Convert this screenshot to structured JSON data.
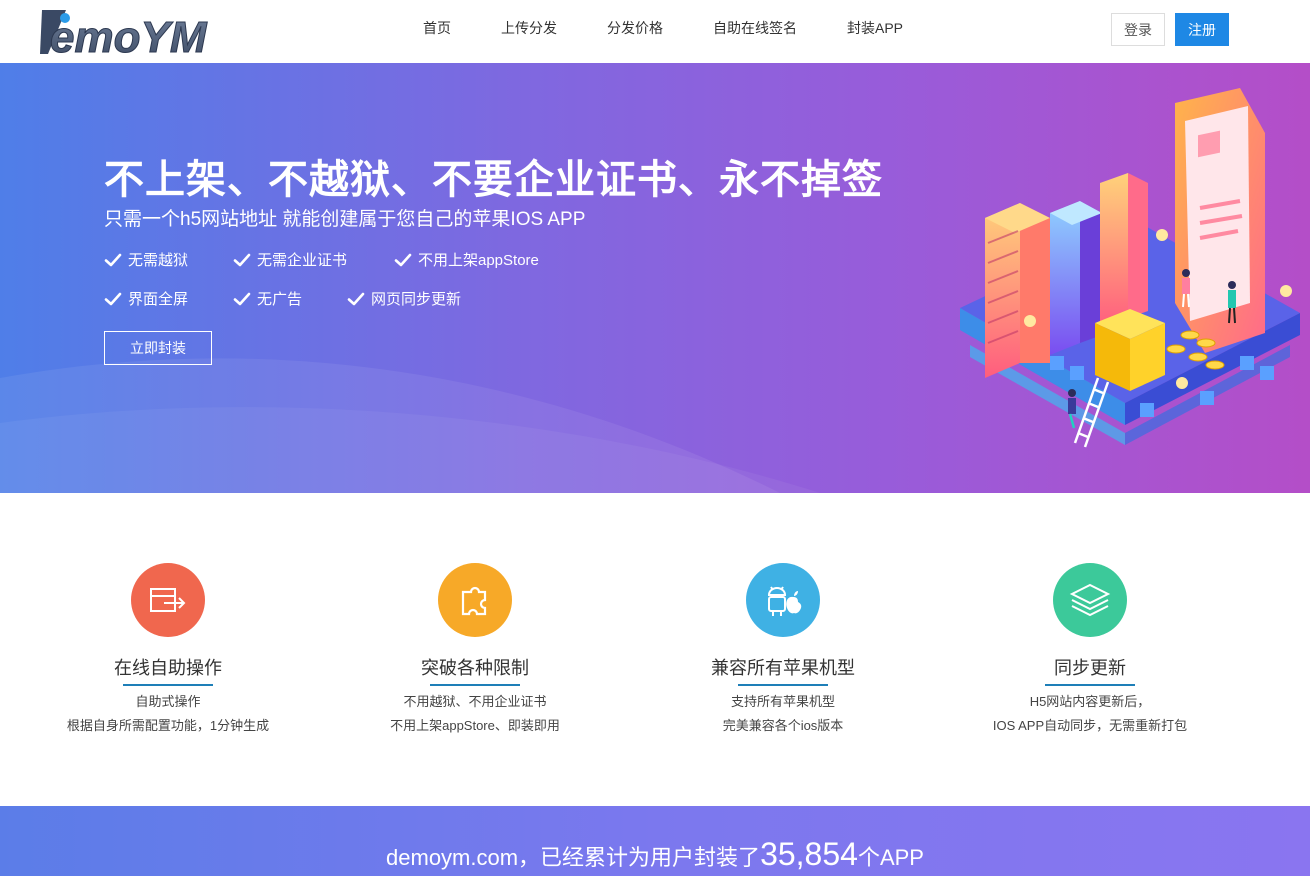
{
  "header": {
    "logo_text": "DemoYM",
    "nav": [
      "首页",
      "上传分发",
      "分发价格",
      "自助在线签名",
      "封装APP"
    ],
    "login_label": "登录",
    "register_label": "注册"
  },
  "hero": {
    "title": "不上架、不越狱、不要企业证书、永不掉签",
    "subtitle": "只需一个h5网站地址 就能创建属于您自己的苹果IOS APP",
    "features_row1": [
      "无需越狱",
      "无需企业证书",
      "不用上架appStore"
    ],
    "features_row2": [
      "界面全屏",
      "无广告",
      "网页同步更新"
    ],
    "button_label": "立即封装"
  },
  "features": [
    {
      "title": "在线自助操作",
      "desc1": "自助式操作",
      "desc2": "根据自身所需配置功能，1分钟生成",
      "color": "#f0674e",
      "icon": "exit-card-icon"
    },
    {
      "title": "突破各种限制",
      "desc1": "不用越狱、不用企业证书",
      "desc2": "不用上架appStore、即装即用",
      "color": "#f7a928",
      "icon": "puzzle-icon"
    },
    {
      "title": "兼容所有苹果机型",
      "desc1": "支持所有苹果机型",
      "desc2": "完美兼容各个ios版本",
      "color": "#3fb1e4",
      "icon": "android-apple-icon"
    },
    {
      "title": "同步更新",
      "desc1": "H5网站内容更新后，",
      "desc2": "IOS APP自动同步，无需重新打包",
      "color": "#3cc99a",
      "icon": "layers-icon"
    }
  ],
  "stat": {
    "prefix": "demoym.com，已经累计为用户封装了",
    "count": "35,854",
    "suffix": "个APP"
  }
}
